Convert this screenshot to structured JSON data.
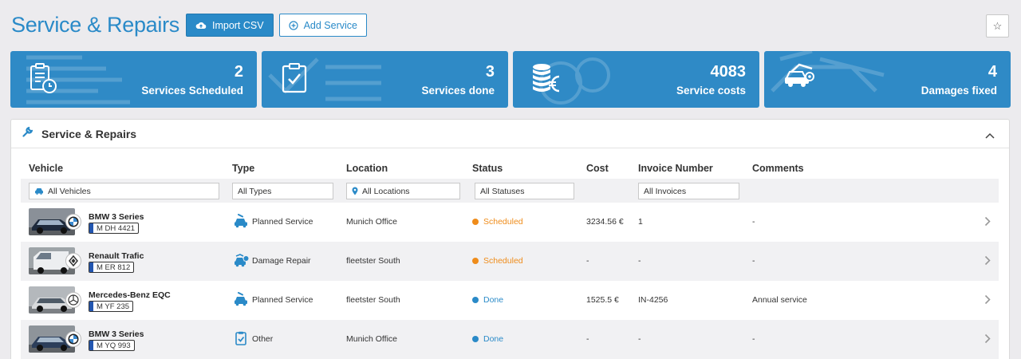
{
  "header": {
    "title": "Service & Repairs",
    "import_label": "Import CSV",
    "add_label": "Add Service",
    "star": "☆"
  },
  "stats": [
    {
      "value": "2",
      "label": "Services Scheduled"
    },
    {
      "value": "3",
      "label": "Services done"
    },
    {
      "value": "4083",
      "label": "Service costs"
    },
    {
      "value": "4",
      "label": "Damages fixed"
    }
  ],
  "panel": {
    "title": "Service & Repairs"
  },
  "table": {
    "columns": [
      "Vehicle",
      "Type",
      "Location",
      "Status",
      "Cost",
      "Invoice Number",
      "Comments"
    ],
    "filters": {
      "vehicle": "All Vehicles",
      "type": "All Types",
      "location": "All Locations",
      "status": "All Statuses",
      "invoice": "All Invoices"
    },
    "rows": [
      {
        "vehicle": "BMW 3 Series",
        "plate": "M DH 4421",
        "type": "Planned Service",
        "location": "Munich Office",
        "status": "Scheduled",
        "cost": "3234.56 €",
        "invoice": "1",
        "comments": "-"
      },
      {
        "vehicle": "Renault Trafic",
        "plate": "M ER 812",
        "type": "Damage Repair",
        "location": "fleetster South",
        "status": "Scheduled",
        "cost": "-",
        "invoice": "-",
        "comments": "-"
      },
      {
        "vehicle": "Mercedes-Benz EQC",
        "plate": "M YF 235",
        "type": "Planned Service",
        "location": "fleetster South",
        "status": "Done",
        "cost": "1525.5 €",
        "invoice": "IN-4256",
        "comments": "Annual service"
      },
      {
        "vehicle": "BMW 3 Series",
        "plate": "M YQ 993",
        "type": "Other",
        "location": "Munich Office",
        "status": "Done",
        "cost": "-",
        "invoice": "-",
        "comments": "-"
      }
    ]
  },
  "colors": {
    "accent": "#2a8ac8",
    "scheduled": "#ef8c1a",
    "done": "#2a8ac8"
  }
}
